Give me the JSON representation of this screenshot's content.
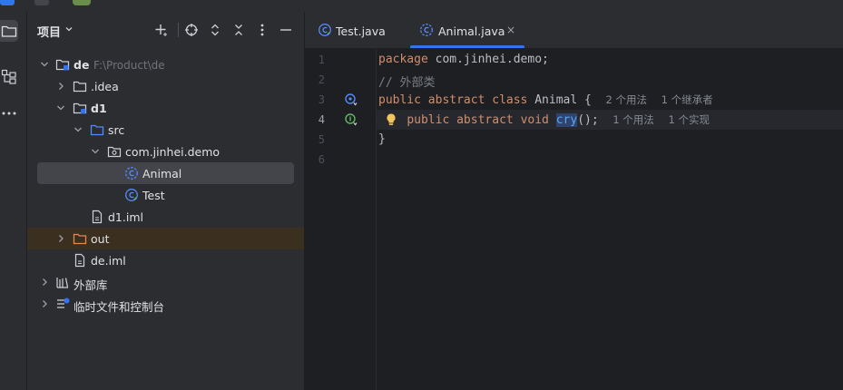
{
  "project_panel": {
    "title": "项目",
    "tree": [
      {
        "label": "de",
        "path": "F:\\Product\\de"
      },
      {
        "label": ".idea"
      },
      {
        "label": "d1"
      },
      {
        "label": "src"
      },
      {
        "label": "com.jinhei.demo"
      },
      {
        "label": "Animal"
      },
      {
        "label": "Test"
      },
      {
        "label": "d1.iml"
      },
      {
        "label": "out"
      },
      {
        "label": "de.iml"
      },
      {
        "label": "外部库"
      },
      {
        "label": "临时文件和控制台"
      }
    ]
  },
  "editor_tabs": [
    {
      "label": "Test.java",
      "active": false
    },
    {
      "label": "Animal.java",
      "active": true,
      "close": "×"
    }
  ],
  "editor": {
    "line_numbers": [
      "1",
      "2",
      "3",
      "4",
      "5",
      "6"
    ],
    "lines": {
      "l1_kw": "package",
      "l1_rest": " com.jinhei.demo;",
      "l2_comment": "// 外部类",
      "l3_kw1": "public",
      "l3_kw2": "abstract",
      "l3_kw3": "class",
      "l3_name": "Animal",
      "l3_brace": "{",
      "l3_hint1": "2 个用法",
      "l3_hint2": "1 个继承者",
      "l4_kw1": "public",
      "l4_kw2": "abstract",
      "l4_kw3": "void",
      "l4_fn": "cry",
      "l4_rest": "();",
      "l4_hint1": "1 个用法",
      "l4_hint2": "1 个实现",
      "l5": "}"
    }
  },
  "colors": {
    "accent": "#3574f0",
    "keyword": "#cf8e6d",
    "comment": "#7a7e85",
    "folder_src": "#548af7",
    "folder_out": "#e08855"
  }
}
